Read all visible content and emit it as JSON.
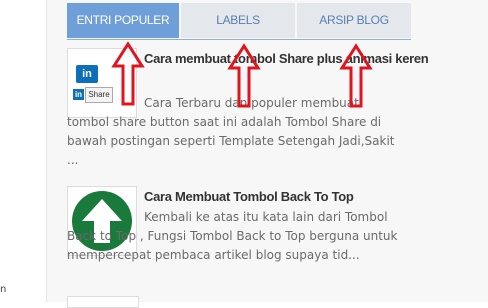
{
  "tabs": [
    {
      "label": "ENTRI POPULER",
      "active": true
    },
    {
      "label": "LABELS",
      "active": false
    },
    {
      "label": "ARSIP BLOG",
      "active": false
    }
  ],
  "posts": [
    {
      "title": "Cara membuat tombol Share plus animasi keren",
      "excerpt": "Cara Terbaru dan populer membuat tombol share button saat ini adalah Tombol Share di bawah postingan seperti Template Setengah Jadi,Sakit ...",
      "thumb_icon": "linkedin-share-icon",
      "thumb_text": {
        "logo": "in",
        "button": "Share"
      }
    },
    {
      "title": "Cara Membuat Tombol Back To Top",
      "excerpt": "Kembali ke atas itu kata lain dari Tombol Back to Top , Fungsi Tombol Back to Top berguna untuk mempercepat pembaca artikel blog supaya tid...",
      "thumb_icon": "up-arrow-icon"
    }
  ],
  "colors": {
    "active_tab": "#6f9fd8",
    "inactive_tab": "#e4e8ed",
    "arrow_annotation": "#e0141e",
    "up_icon_bg": "#1a7a3c"
  }
}
